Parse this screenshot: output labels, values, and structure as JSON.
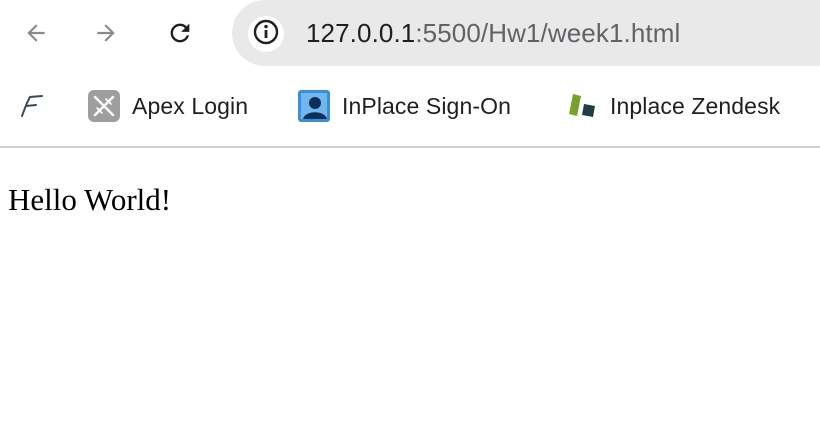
{
  "browser": {
    "nav": {
      "back_icon": "arrow-left-icon",
      "forward_icon": "arrow-right-icon",
      "reload_icon": "reload-icon"
    },
    "address_bar": {
      "site_info_icon": "info-icon",
      "host": "127.0.0.1",
      "rest": ":5500/Hw1/week1.html"
    },
    "bookmarks": [
      {
        "label": "",
        "icon": "f-logo-icon"
      },
      {
        "label": "Apex Login",
        "icon": "apex-logo-icon"
      },
      {
        "label": "InPlace Sign-On",
        "icon": "user-profile-icon"
      },
      {
        "label": "Inplace Zendesk",
        "icon": "zendesk-logo-icon"
      }
    ]
  },
  "page": {
    "text": "Hello World!"
  },
  "colors": {
    "omnibox_bg": "#e9e9e9",
    "text": "#1f1f1f",
    "muted": "#5f6368",
    "divider": "#d0d0d0"
  }
}
